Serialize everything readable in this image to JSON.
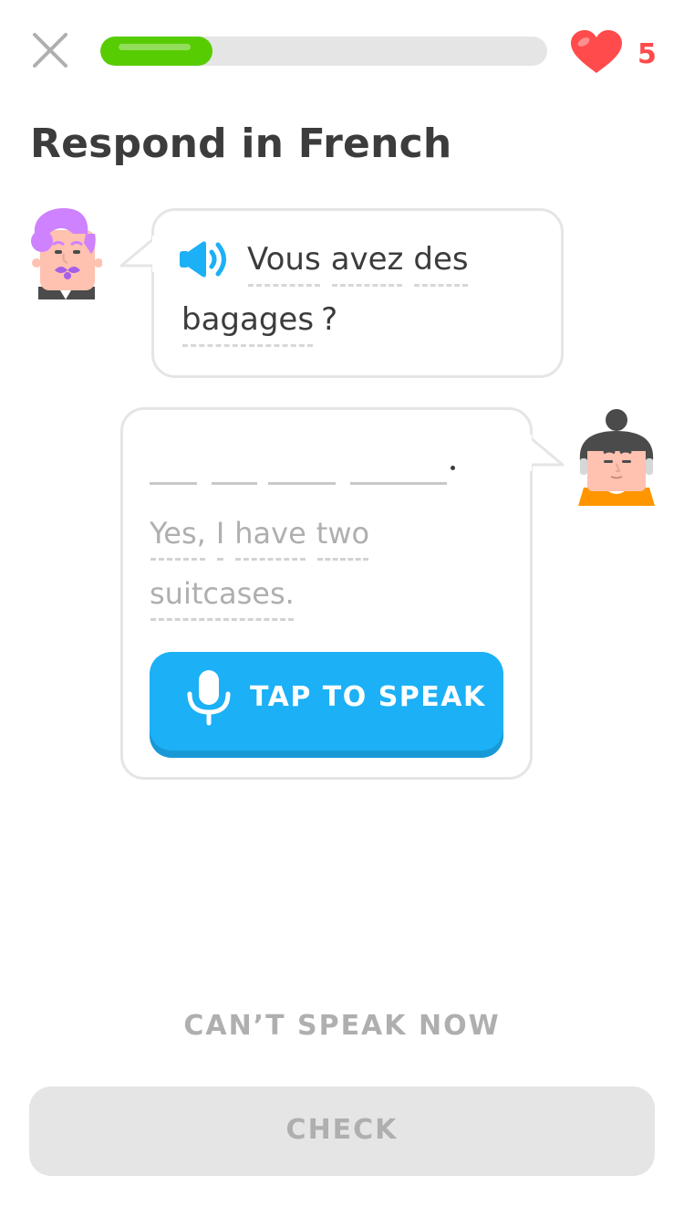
{
  "header": {
    "close_icon": "close-icon",
    "progress_fraction": 0.25,
    "hearts_icon": "heart-icon",
    "hearts_count": "5",
    "colors": {
      "progress": "#58cc02",
      "heart": "#ff4b4b"
    }
  },
  "title": "Respond in French",
  "prompt": {
    "speaker_icon": "speaker-icon",
    "line1": [
      "Vous",
      "avez",
      "des"
    ],
    "line2": [
      "bagages",
      "?"
    ]
  },
  "response": {
    "blanks": 4,
    "end_punctuation": ".",
    "hint_line1": [
      "Yes,",
      "I",
      "have",
      "two"
    ],
    "hint_line2": [
      "suitcases."
    ]
  },
  "speak_button": {
    "icon": "microphone-icon",
    "label": "TAP TO SPEAK",
    "color": "#1cb0f6"
  },
  "cant_speak_label": "CAN’T SPEAK NOW",
  "check_label": "CHECK"
}
